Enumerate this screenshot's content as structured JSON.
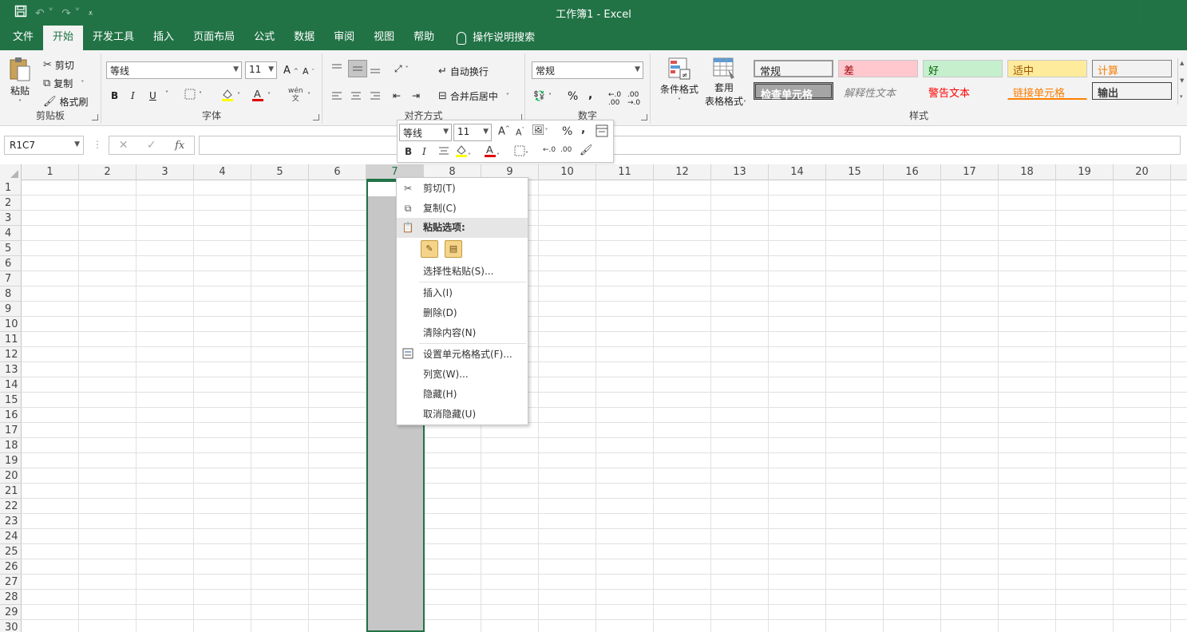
{
  "window": {
    "title": "工作簿1  -  Excel",
    "qat": {
      "save_icon": "save-icon",
      "undo_icon": "undo-icon",
      "redo_icon": "redo-icon",
      "customize_icon": "customize-qat-icon"
    }
  },
  "tabs": [
    "文件",
    "开始",
    "开发工具",
    "插入",
    "页面布局",
    "公式",
    "数据",
    "审阅",
    "视图",
    "帮助"
  ],
  "active_tab": "开始",
  "tell_me": "操作说明搜索",
  "ribbon": {
    "clipboard": {
      "label": "剪贴板",
      "paste": "粘贴",
      "cut": "剪切",
      "copy": "复制",
      "format_painter": "格式刷"
    },
    "font": {
      "label": "字体",
      "font_name": "等线",
      "font_size": "11",
      "bold": "B",
      "italic": "I",
      "underline": "U",
      "wen": "wén",
      "wen_sub": "文"
    },
    "alignment": {
      "label": "对齐方式",
      "wrap_text": "自动换行",
      "merge_center": "合并后居中"
    },
    "number": {
      "label": "数字",
      "format": "常规",
      "percent": "%",
      "comma": ","
    },
    "styles_group": {
      "label": "样式",
      "conditional_formatting": "条件格式",
      "format_as_table_line1": "套用",
      "format_as_table_line2": "表格格式",
      "cells": [
        {
          "label": "常规",
          "bg": "#ffffff",
          "color": "#000000"
        },
        {
          "label": "差",
          "bg": "#ffc7ce",
          "color": "#9c0006"
        },
        {
          "label": "好",
          "bg": "#c6efce",
          "color": "#006100"
        },
        {
          "label": "适中",
          "bg": "#ffeb9c",
          "color": "#9c5700"
        },
        {
          "label": "计算",
          "bg": "#f2f2f2",
          "color": "#fa7d00"
        },
        {
          "label": "检查单元格",
          "bg": "#a5a5a5",
          "color": "#ffffff"
        },
        {
          "label": "解释性文本",
          "bg": "#ffffff",
          "color": "#7f7f7f"
        },
        {
          "label": "警告文本",
          "bg": "#ffffff",
          "color": "#ff0000"
        },
        {
          "label": "链接单元格",
          "bg": "#ffffff",
          "color": "#fa7d00"
        },
        {
          "label": "输出",
          "bg": "#f2f2f2",
          "color": "#3f3f3f"
        }
      ]
    }
  },
  "formula_bar": {
    "name_box": "R1C7",
    "fx": "fx",
    "formula": ""
  },
  "grid": {
    "columns": [
      "1",
      "2",
      "3",
      "4",
      "5",
      "6",
      "7",
      "8",
      "9",
      "10",
      "11",
      "12",
      "13",
      "14",
      "15",
      "16",
      "17",
      "18",
      "19",
      "20"
    ],
    "rows": [
      "1",
      "2",
      "3",
      "4",
      "5",
      "6",
      "7",
      "8",
      "9",
      "10",
      "11",
      "12",
      "13",
      "14",
      "15",
      "16",
      "17",
      "18",
      "19",
      "20",
      "21",
      "22",
      "23",
      "24",
      "25",
      "26",
      "27",
      "28",
      "29",
      "30"
    ],
    "selected_column": "7"
  },
  "mini_toolbar": {
    "font_name": "等线",
    "font_size": "11",
    "bold": "B",
    "italic": "I",
    "percent": "%",
    "comma": ","
  },
  "context_menu": {
    "cut": "剪切(T)",
    "copy": "复制(C)",
    "paste_options": "粘贴选项:",
    "paste_special": "选择性粘贴(S)...",
    "insert": "插入(I)",
    "delete": "删除(D)",
    "clear_contents": "清除内容(N)",
    "format_cells": "设置单元格格式(F)...",
    "column_width": "列宽(W)...",
    "hide": "隐藏(H)",
    "unhide": "取消隐藏(U)"
  },
  "colors": {
    "accent": "#217346",
    "ribbon_bg": "#f3f3f3",
    "selection": "#c6c6c6"
  }
}
